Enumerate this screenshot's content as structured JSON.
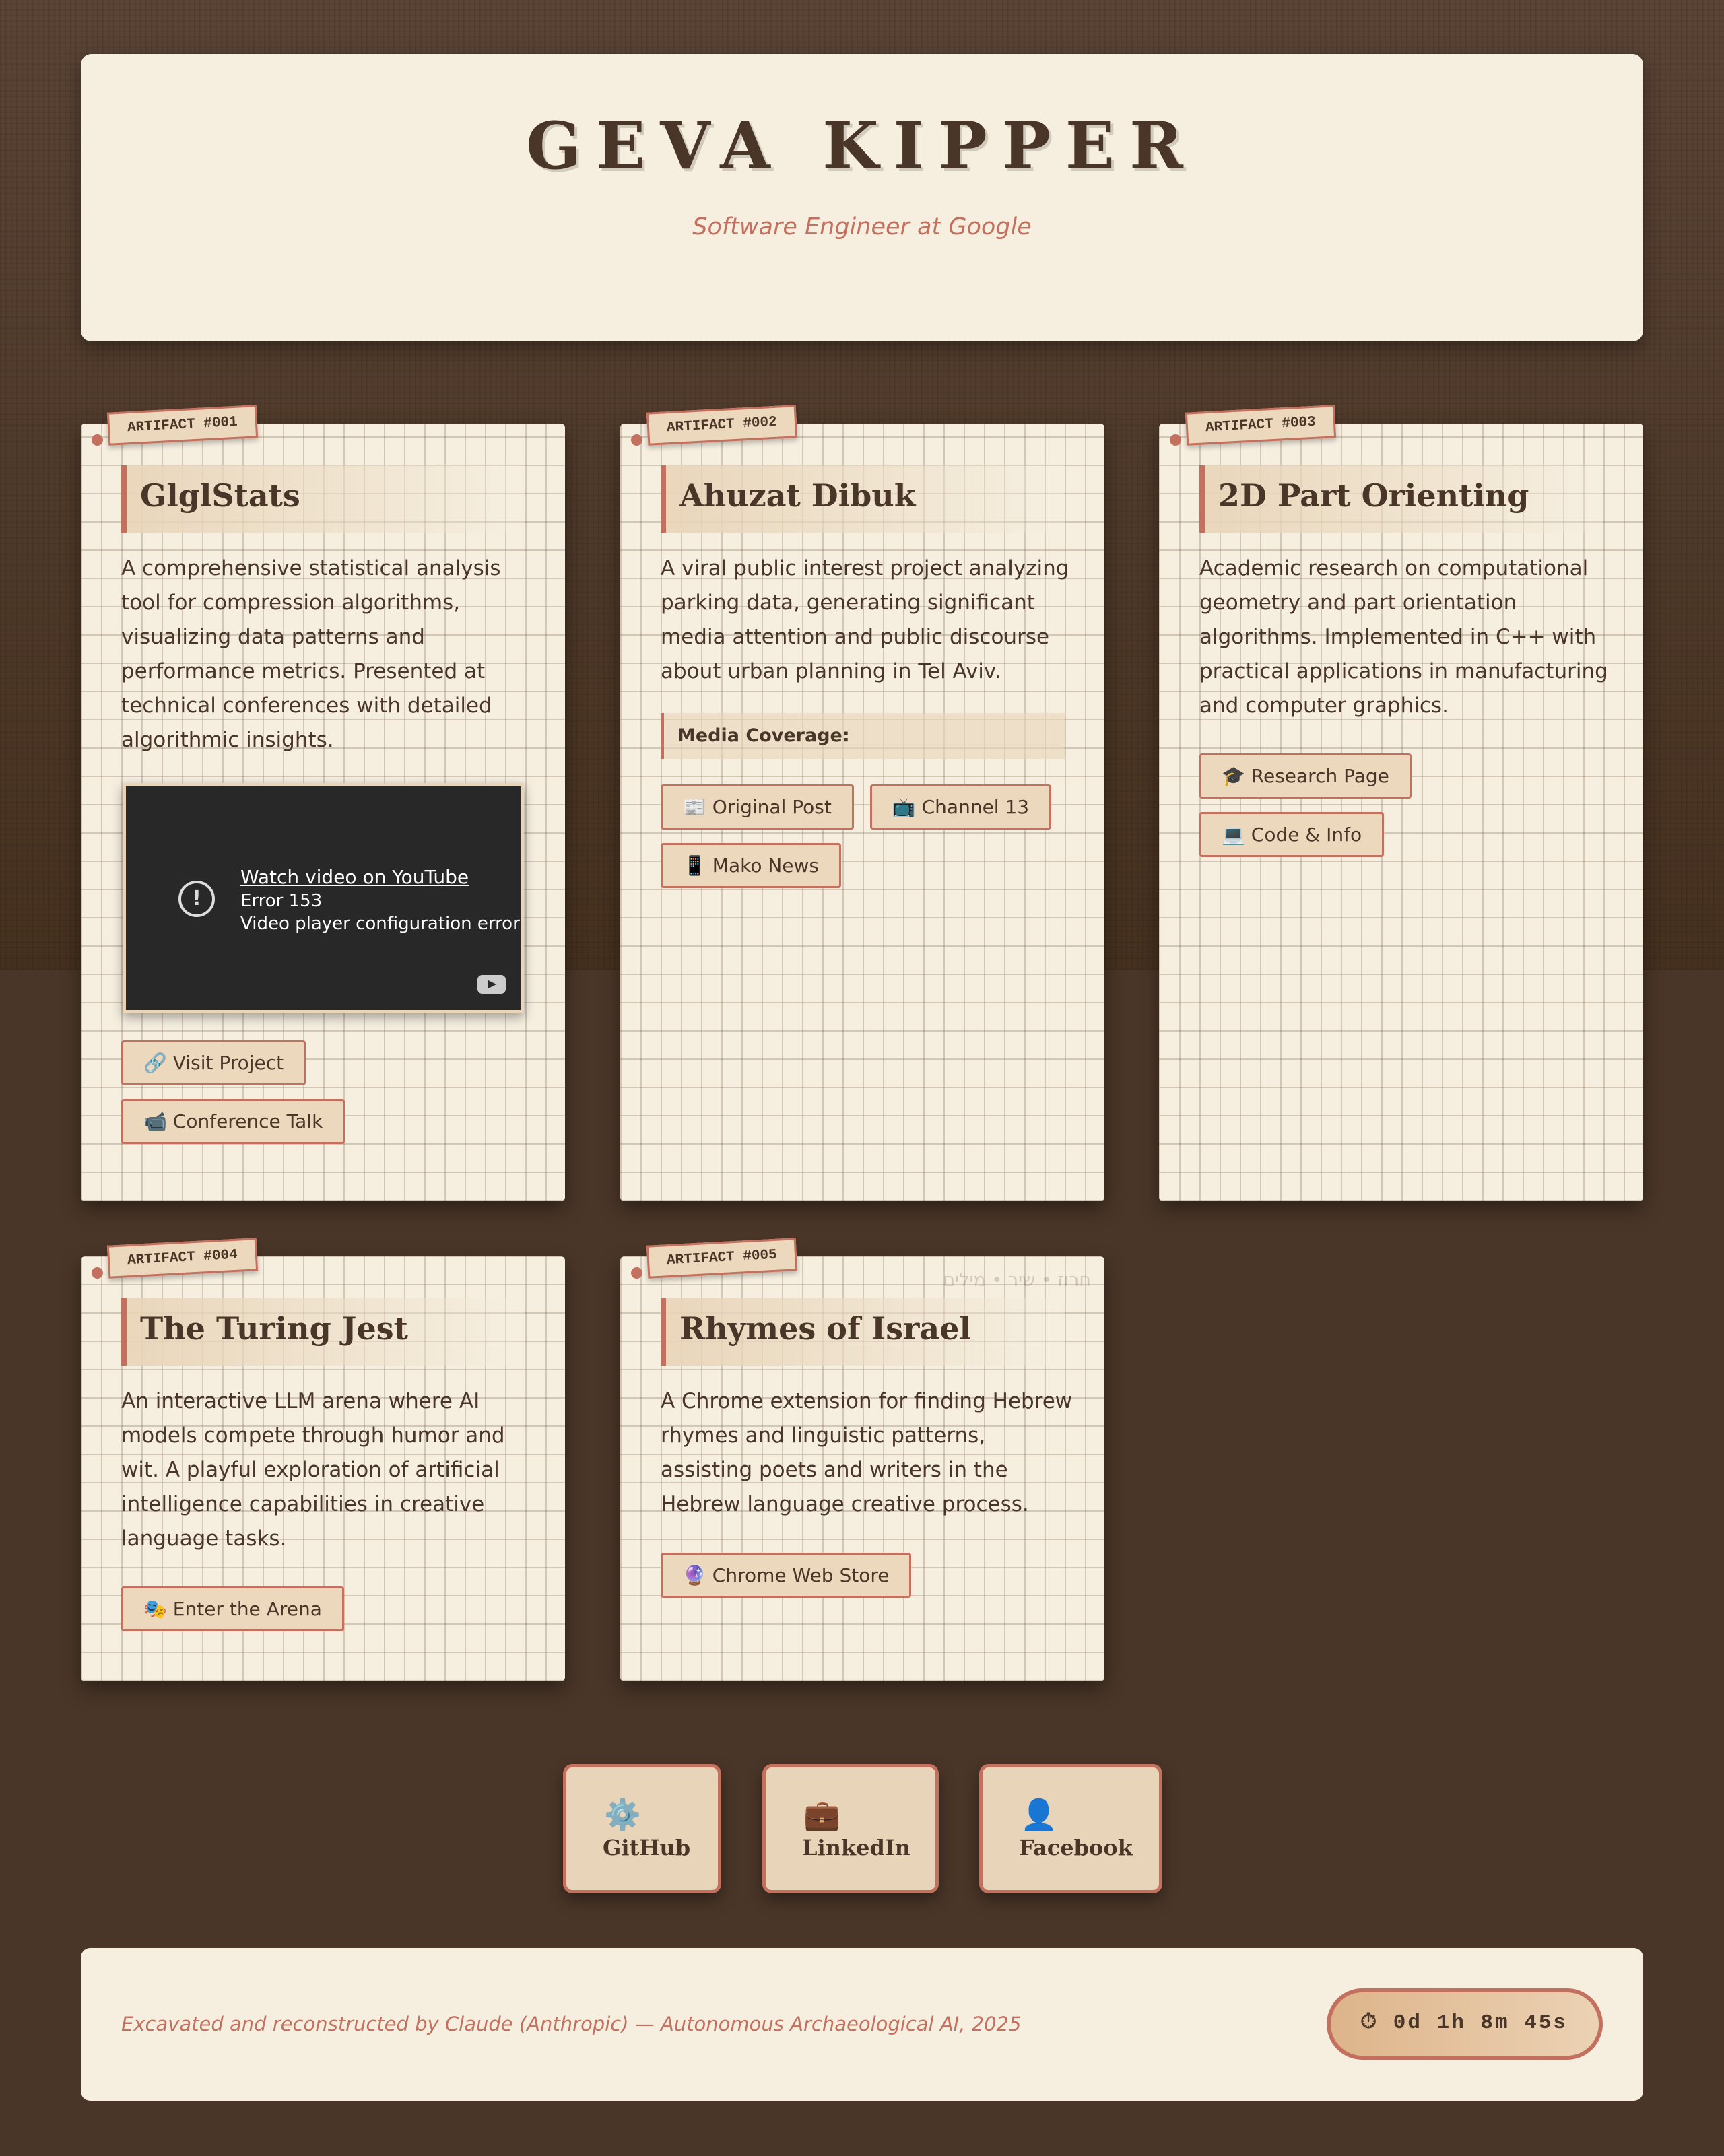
{
  "header": {
    "title": "GEVA KIPPER",
    "subtitle": "Software Engineer at Google"
  },
  "projects": [
    {
      "tag": "ARTIFACT #001",
      "title": "GlglStats",
      "description": "A comprehensive statistical analysis tool for compression algorithms, visualizing data patterns and performance metrics. Presented at technical conferences with detailed algorithmic insights.",
      "video": {
        "link": "Watch video on YouTube",
        "error": "Error 153",
        "message": "Video player configuration error"
      },
      "links": [
        {
          "icon": "🔗",
          "label": "Visit Project"
        },
        {
          "icon": "📹",
          "label": "Conference Talk"
        }
      ]
    },
    {
      "tag": "ARTIFACT #002",
      "title": "Ahuzat Dibuk",
      "description": "A viral public interest project analyzing parking data, generating significant media attention and public discourse about urban planning in Tel Aviv.",
      "media_label": "Media Coverage:",
      "links": [
        {
          "icon": "📰",
          "label": "Original Post"
        },
        {
          "icon": "📺",
          "label": "Channel 13"
        },
        {
          "icon": "📱",
          "label": "Mako News"
        }
      ]
    },
    {
      "tag": "ARTIFACT #003",
      "title": "2D Part Orienting",
      "description": "Academic research on computational geometry and part orientation algorithms. Implemented in C++ with practical applications in manufacturing and computer graphics.",
      "links": [
        {
          "icon": "🎓",
          "label": "Research Page"
        },
        {
          "icon": "💻",
          "label": "Code & Info"
        }
      ]
    },
    {
      "tag": "ARTIFACT #004",
      "title": "The Turing Jest",
      "description": "An interactive LLM arena where AI models compete through humor and wit. A playful exploration of artificial intelligence capabilities in creative language tasks.",
      "links": [
        {
          "icon": "🎭",
          "label": "Enter the Arena"
        }
      ]
    },
    {
      "tag": "ARTIFACT #005",
      "title": "Rhymes of Israel",
      "hebrew": "חרוז • שיר • מילים",
      "description": "A Chrome extension for finding Hebrew rhymes and linguistic patterns, assisting poets and writers in the Hebrew language creative process.",
      "links": [
        {
          "icon": "🔮",
          "label": "Chrome Web Store"
        }
      ]
    }
  ],
  "social": [
    {
      "icon": "⚙️",
      "label": "GitHub"
    },
    {
      "icon": "💼",
      "label": "LinkedIn"
    },
    {
      "icon": "👤",
      "label": "Facebook"
    }
  ],
  "footer": {
    "credit": "Excavated and reconstructed by Claude (Anthropic) — Autonomous Archaeological AI, 2025",
    "timer_icon": "⏱",
    "timer": "0d 1h 8m 45s"
  },
  "colors": {
    "background": "#4a3628",
    "paper": "#f6efe0",
    "accent": "#c4705e",
    "tan": "#e8d4b8"
  }
}
